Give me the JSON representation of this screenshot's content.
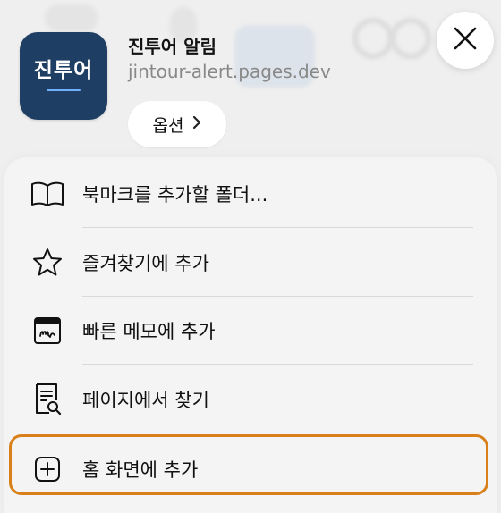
{
  "app": {
    "icon_text": "진투어",
    "title": "진투어 알림",
    "url": "jintour-alert.pages.dev"
  },
  "options_button": {
    "label": "옵션",
    "icon": "chevron-right-icon"
  },
  "close_button": {
    "icon": "close-icon"
  },
  "menu": {
    "items": [
      {
        "label": "북마크를 추가할 폴더...",
        "icon": "book-icon"
      },
      {
        "label": "즐겨찾기에 추가",
        "icon": "star-icon"
      },
      {
        "label": "빠른 메모에 추가",
        "icon": "quick-note-icon"
      },
      {
        "label": "페이지에서 찾기",
        "icon": "find-in-page-icon"
      },
      {
        "label": "홈 화면에 추가",
        "icon": "add-square-icon"
      }
    ]
  },
  "colors": {
    "app_icon_bg": "#1e3e63",
    "highlight": "#d9801a"
  }
}
